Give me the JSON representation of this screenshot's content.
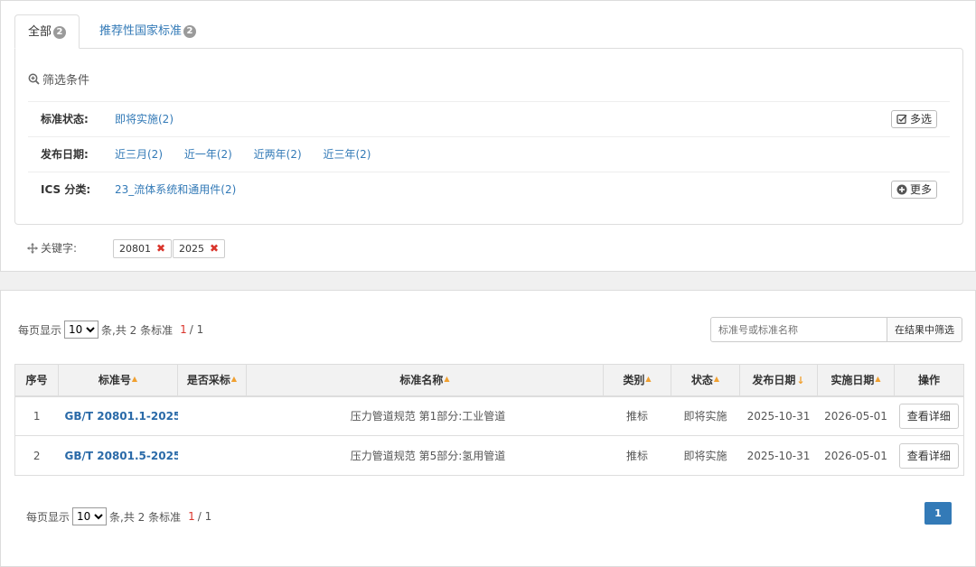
{
  "tabs": [
    {
      "label": "全部",
      "count": "2"
    },
    {
      "label": "推荐性国家标准",
      "count": "2"
    }
  ],
  "filter": {
    "title": "筛选条件",
    "rows": [
      {
        "label": "标准状态:",
        "options": [
          "即将实施(2)"
        ],
        "action": "多选"
      },
      {
        "label": "发布日期:",
        "options": [
          "近三月(2)",
          "近一年(2)",
          "近两年(2)",
          "近三年(2)"
        ]
      },
      {
        "label": "ICS 分类:",
        "options": [
          "23_流体系统和通用件(2)"
        ],
        "action": "更多"
      }
    ]
  },
  "keywords": {
    "label": "关键字:",
    "tags": [
      "20801",
      "2025"
    ]
  },
  "pager": {
    "per_page_label": "每页显示",
    "per_page_value": "10",
    "summary": "条,共 2 条标准",
    "current_page": "1",
    "total_pages": "/ 1",
    "page_button": "1"
  },
  "search": {
    "placeholder": "标准号或标准名称",
    "button": "在结果中筛选"
  },
  "table": {
    "headers": [
      "序号",
      "标准号",
      "是否采标",
      "标准名称",
      "类别",
      "状态",
      "发布日期",
      "实施日期",
      "操作"
    ],
    "rows": [
      {
        "index": "1",
        "std_no": "GB/T 20801.1-2025",
        "adopted": "",
        "name": "压力管道规范 第1部分:工业管道",
        "category": "推标",
        "status": "即将实施",
        "publish": "2025-10-31",
        "implement": "2026-05-01",
        "action": "查看详细"
      },
      {
        "index": "2",
        "std_no": "GB/T 20801.5-2025",
        "adopted": "",
        "name": "压力管道规范 第5部分:氢用管道",
        "category": "推标",
        "status": "即将实施",
        "publish": "2025-10-31",
        "implement": "2026-05-01",
        "action": "查看详细"
      }
    ]
  }
}
